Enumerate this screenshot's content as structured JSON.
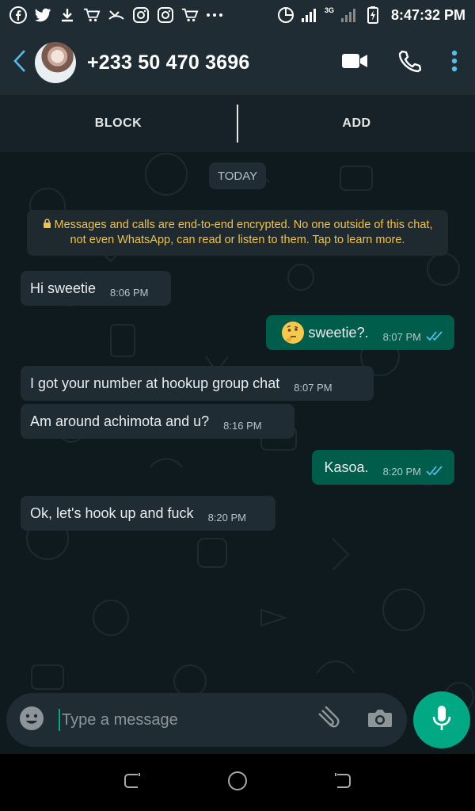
{
  "status_bar": {
    "time": "8:47:32 PM",
    "network_label": "3G",
    "icons": [
      "facebook-icon",
      "twitter-icon",
      "download-icon",
      "cart-icon",
      "missed-call-icon",
      "instagram-icon",
      "instagram-icon",
      "cart-icon",
      "more-dots-icon",
      "data-saver-icon",
      "signal-icon",
      "signal-icon",
      "battery-icon"
    ]
  },
  "header": {
    "contact_name": "+233 50 470 3696",
    "icons": [
      "back-arrow-icon",
      "video-call-icon",
      "phone-icon",
      "more-vert-icon"
    ]
  },
  "actions": {
    "block_label": "BLOCK",
    "add_label": "ADD"
  },
  "chat": {
    "date_chip": "TODAY",
    "encryption_notice": "Messages and calls are end-to-end encrypted. No one outside of this chat, not even WhatsApp, can read or listen to them. Tap to learn more.",
    "messages": [
      {
        "direction": "incoming",
        "text": "Hi sweetie",
        "time": "8:06 PM"
      },
      {
        "direction": "outgoing",
        "emoji": "thinking-face-icon",
        "text": "sweetie?.",
        "time": "8:07 PM",
        "status": "read"
      },
      {
        "direction": "incoming",
        "text": "I got your number at hookup group chat",
        "time": "8:07 PM"
      },
      {
        "direction": "incoming",
        "text": "Am around achimota and u?",
        "time": "8:16 PM"
      },
      {
        "direction": "outgoing",
        "text": "Kasoa.",
        "time": "8:20 PM",
        "status": "read"
      },
      {
        "direction": "incoming",
        "text": "Ok, let's hook up and fuck",
        "time": "8:20 PM"
      }
    ]
  },
  "composer": {
    "placeholder": "Type a message"
  },
  "colors": {
    "header_bg": "#1f2c34",
    "incoming_bubble": "#1f2c34",
    "outgoing_bubble": "#005c4b",
    "accent": "#00a884",
    "read_ticks": "#53bdeb",
    "encryption_text": "#f0c24b"
  }
}
